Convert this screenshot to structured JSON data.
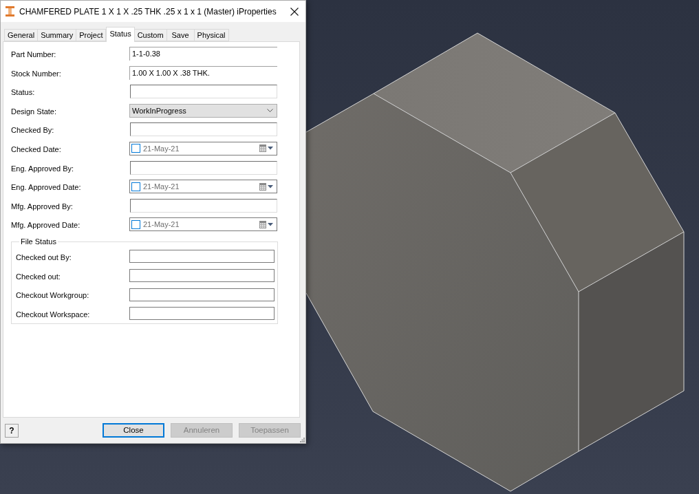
{
  "window": {
    "title": "CHAMFERED PLATE 1 X 1 X .25 THK .25 x 1 x 1 (Master) iProperties"
  },
  "tabs": [
    {
      "label": "General",
      "selected": false
    },
    {
      "label": "Summary",
      "selected": false
    },
    {
      "label": "Project",
      "selected": false
    },
    {
      "label": "Status",
      "selected": true
    },
    {
      "label": "Custom",
      "selected": false
    },
    {
      "label": "Save",
      "selected": false
    },
    {
      "label": "Physical",
      "selected": false
    }
  ],
  "fields": [
    {
      "kind": "flat_text",
      "label": "Part Number:",
      "value": "1-1-0.38"
    },
    {
      "kind": "flat_text",
      "label": "Stock Number:",
      "value": "1.00 X 1.00 X .38 THK."
    },
    {
      "kind": "text",
      "label": "Status:"
    },
    {
      "kind": "dropdown",
      "label": "Design State:",
      "value": "WorkInProgress"
    },
    {
      "kind": "text",
      "label": "Checked By:"
    },
    {
      "kind": "date",
      "label": "Checked Date:",
      "value": "21-May-21",
      "checked": false
    },
    {
      "kind": "text",
      "label": "Eng. Approved By:"
    },
    {
      "kind": "date",
      "label": "Eng. Approved Date:",
      "value": "21-May-21",
      "checked": false
    },
    {
      "kind": "text",
      "label": "Mfg. Approved By:"
    },
    {
      "kind": "date",
      "label": "Mfg. Approved Date:",
      "value": "21-May-21",
      "checked": false
    }
  ],
  "file_status": {
    "title": "File Status",
    "fields": [
      {
        "label": "Checked out By:"
      },
      {
        "label": "Checked out:"
      },
      {
        "label": "Checkout Workgroup:"
      },
      {
        "label": "Checkout Workspace:"
      }
    ]
  },
  "help_button": {
    "glyph": "?"
  },
  "buttons": [
    {
      "label": "Close",
      "focused": true,
      "disabled": false
    },
    {
      "label": "Annuleren",
      "focused": false,
      "disabled": true
    },
    {
      "label": "Toepassen",
      "focused": false,
      "disabled": true
    }
  ]
}
